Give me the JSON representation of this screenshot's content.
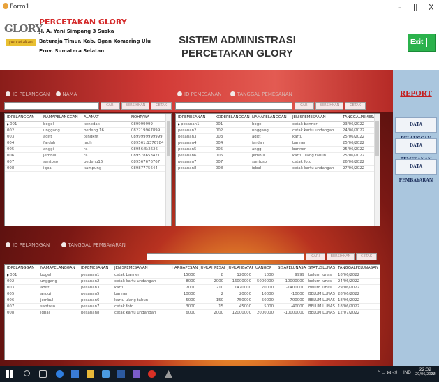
{
  "window": {
    "title": "Form1",
    "minimize": "–",
    "maximize": "ǀǀ",
    "close": "X"
  },
  "header": {
    "logo_main": "GLORY",
    "logo_sub": "percetakan",
    "company_name": "PERCETAKAN GLORY",
    "address_1": "Jl. A. Yani Simpang 3 Suska",
    "address_2": "Baturaja Timur, Kab. Ogan Komering Ulu",
    "address_3": "Prov. Sumatera Selatan",
    "title_1": "SISTEM ADMINISTRASI",
    "title_2": "PERCETAKAN GLORY",
    "exit_label": "Exit"
  },
  "sidebar": {
    "report_label": "REPORT",
    "buttons": [
      "DATA PELANGGAN",
      "DATA PEMESANAN",
      "DATA PEMBAYARAN"
    ]
  },
  "pelanggan": {
    "radio_1": "ID PELANGGAN",
    "radio_2": "NAMA",
    "btn_cari": "CARI",
    "btn_bersihkan": "BERSIHKAN",
    "btn_cetak": "CETAK",
    "columns": [
      "IDPELANGGAN",
      "NAMAPELANGGAN",
      "ALAMAT",
      "NOHP/WA"
    ],
    "rows": [
      [
        "001",
        "bogel",
        "kenedak",
        "089999999"
      ],
      [
        "002",
        "unggang",
        "bedeng 16",
        "082219967899"
      ],
      [
        "003",
        "aditt",
        "tengkrit",
        "0899999999999"
      ],
      [
        "004",
        "fardah",
        "jauh",
        "089561:1376784"
      ],
      [
        "005",
        "anggi",
        "ra",
        "08956:5:2626"
      ],
      [
        "006",
        "jembul",
        "ra",
        "089578653421"
      ],
      [
        "007",
        "santoso",
        "bedeng16",
        "089567676767"
      ],
      [
        "008",
        "iqbal",
        "kampung",
        "08987775644"
      ]
    ]
  },
  "pemesanan": {
    "radio_1": "ID PEMESANAN",
    "radio_2": "TANGGAL PEMESANAN",
    "btn_cari": "CARI",
    "btn_bersihkan": "BERSIHKAN",
    "btn_cetak": "CETAK",
    "columns": [
      "IDPEMESANAN",
      "KODEPELANGGAN",
      "NAMAPELANGGAN",
      "JENISPEMESANAN",
      "TANGGALPEMESANAN"
    ],
    "rows": [
      [
        "pesanan1",
        "001",
        "bogel",
        "cetak banner",
        "23/06/2022"
      ],
      [
        "pesanan2",
        "002",
        "unggang",
        "cetak kartu undangan",
        "24/06/2022"
      ],
      [
        "pesanan3",
        "003",
        "aditt",
        "kartu",
        "25/06/2022"
      ],
      [
        "pesanan4",
        "004",
        "fardah",
        "banner",
        "25/06/2022"
      ],
      [
        "pesanan5",
        "005",
        "anggi",
        "banner",
        "25/06/2022"
      ],
      [
        "pesanan6",
        "006",
        "jembul",
        "kartu ulang tahun",
        "25/06/2022"
      ],
      [
        "pesanan7",
        "007",
        "santoso",
        "cetak foto",
        "26/06/2022"
      ],
      [
        "pesanan8",
        "008",
        "iqbal",
        "cetak kartu undangan",
        "27/06/2022"
      ]
    ]
  },
  "pembayaran": {
    "radio_1": "ID PELANGGAN",
    "radio_2": "TANGGAL PEMBAYARAN",
    "btn_cari": "CARI",
    "btn_bersihkan": "BERSIHKAN",
    "btn_cetak": "CETAK",
    "columns": [
      "IDPELANGGAN",
      "NAMAPELANGGAN",
      "IDPEMESANAN",
      "JENISPEMESANAN",
      "HARGAPESANAN",
      "JUMLAHPESANAN",
      "JUMLAHBAYAR",
      "UANGDP",
      "SISAPELUNASAN",
      "STATUSLUNAS",
      "TANGGALPELUNASAN"
    ],
    "rows": [
      [
        "001",
        "bogel",
        "pesanan1",
        "cetak banner",
        "15000",
        "8",
        "120000",
        "1000",
        "9999",
        "belum lunas",
        "18/06/2022"
      ],
      [
        "002",
        "unggang",
        "pesanan2",
        "cetak kartu undangan",
        "8000",
        "2000",
        "16000000",
        "5000000",
        "10000000",
        "belum lunas",
        "24/06/2022"
      ],
      [
        "003",
        "aditt",
        "pesanan3",
        "kartu",
        "7000",
        "210",
        "1470000",
        "70000",
        "-1400000",
        "belum lunas",
        "29/06/2022"
      ],
      [
        "005",
        "anggi",
        "pesanan5",
        "banner",
        "10000",
        "2",
        "20000",
        "10000",
        "-10000",
        "BELUM LUNAS",
        "28/06/2022"
      ],
      [
        "006",
        "jembul",
        "pesanan6",
        "kartu ulang tahun",
        "5000",
        "150",
        "750000",
        "50000",
        "-700000",
        "BELUM LUNAS",
        "18/06/2022"
      ],
      [
        "007",
        "santoso",
        "pesanan7",
        "cetak foto",
        "3000",
        "15",
        "45000",
        "5000",
        "-40000",
        "BELUM LUNAS",
        "18/06/2022"
      ],
      [
        "008",
        "iqbal",
        "pesanan8",
        "cetak kartu undangan",
        "6000",
        "2000",
        "12000000",
        "2000000",
        "-10000000",
        "BELUM LUNAS",
        "12/07/2022"
      ]
    ]
  },
  "taskbar": {
    "lang": "IND",
    "time": "22:32",
    "date": "29/06/2022"
  },
  "colors": {
    "accent_red": "#d42a2a",
    "exit_green": "#2bb24c",
    "side_blue": "#aac6de",
    "taskbar": "#111a24"
  }
}
